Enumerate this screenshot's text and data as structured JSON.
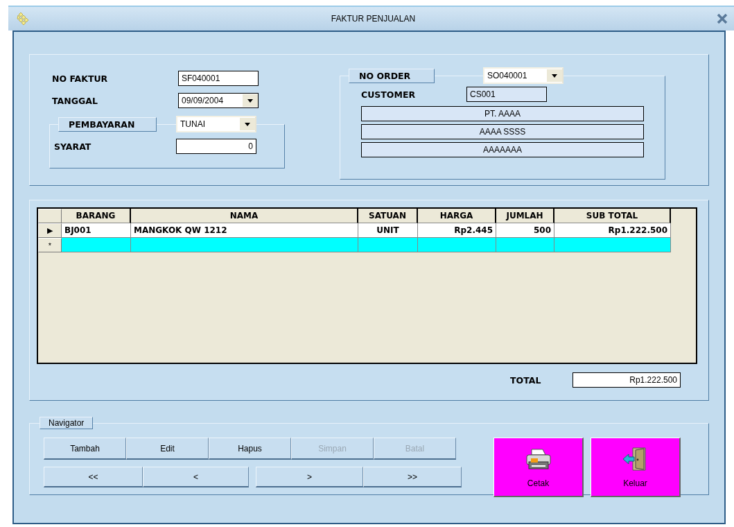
{
  "window": {
    "title": "FAKTUR PENJUALAN"
  },
  "header": {
    "no_faktur": {
      "label": "NO FAKTUR",
      "value": "SF040001"
    },
    "tanggal": {
      "label": "TANGGAL",
      "value": "09/09/2004"
    },
    "pembayaran": {
      "label": "PEMBAYARAN",
      "value": "TUNAI"
    },
    "syarat": {
      "label": "SYARAT",
      "value": "0"
    },
    "no_order": {
      "label": "NO ORDER",
      "value": "SO040001"
    },
    "customer": {
      "label": "CUSTOMER",
      "value": "CS001"
    },
    "customer_lines": [
      "PT. AAAA",
      "AAAA  SSSS",
      "AAAAAAA"
    ]
  },
  "table": {
    "columns": [
      "BARANG",
      "NAMA",
      "SATUAN",
      "HARGA",
      "JUMLAH",
      "SUB TOTAL"
    ],
    "rows": [
      {
        "indicator": "▶",
        "kind": "current",
        "cells": [
          "BJ001",
          "MANGKOK QW 1212",
          "UNIT",
          "Rp2.445",
          "500",
          "Rp1.222.500"
        ]
      },
      {
        "indicator": "*",
        "kind": "new",
        "cells": [
          "",
          "",
          "",
          "",
          "",
          ""
        ]
      }
    ]
  },
  "total": {
    "label": "TOTAL",
    "value": "Rp1.222.500"
  },
  "navigator": {
    "label": "Navigator",
    "buttons": [
      {
        "label": "Tambah",
        "disabled": false
      },
      {
        "label": "Edit",
        "disabled": false
      },
      {
        "label": "Hapus",
        "disabled": false
      },
      {
        "label": "Simpan",
        "disabled": true
      },
      {
        "label": "Batal",
        "disabled": true
      }
    ],
    "moves": [
      "<<",
      "<",
      ">",
      ">>"
    ]
  },
  "actions": [
    {
      "label": "Cetak",
      "kind": "print"
    },
    {
      "label": "Keluar",
      "kind": "exit"
    }
  ]
}
